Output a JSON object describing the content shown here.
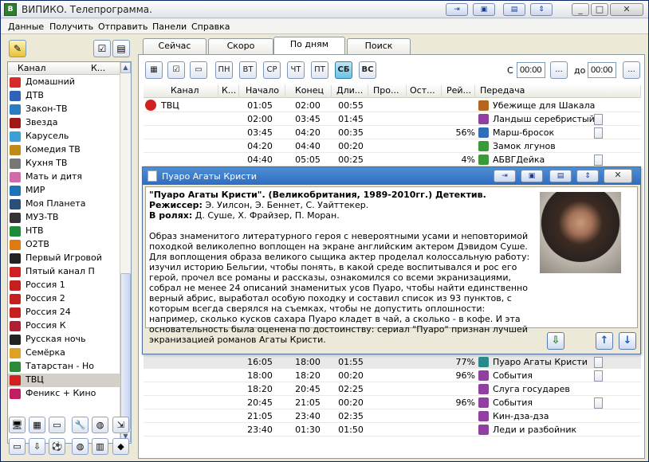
{
  "window": {
    "title": "ВИПИКО. Телепрограмма."
  },
  "menu": [
    "Данные",
    "Получить",
    "Отправить",
    "Панели",
    "Справка"
  ],
  "left_panel": {
    "headers": {
      "channel": "Канал",
      "short": "К..."
    },
    "channels": [
      {
        "name": "Домашний",
        "color": "#d72a2a"
      },
      {
        "name": "ДТВ",
        "color": "#3062b8"
      },
      {
        "name": "Закон-ТВ",
        "color": "#2c7cc1"
      },
      {
        "name": "Звезда",
        "color": "#a01818"
      },
      {
        "name": "Карусель",
        "color": "#3aa0d8"
      },
      {
        "name": "Комедия ТВ",
        "color": "#c08a18"
      },
      {
        "name": "Кухня ТВ",
        "color": "#777777"
      },
      {
        "name": "Мать и дитя",
        "color": "#d06aa8"
      },
      {
        "name": "МИР",
        "color": "#1c74b8"
      },
      {
        "name": "Моя Планета",
        "color": "#2a4f7a"
      },
      {
        "name": "МУЗ-ТВ",
        "color": "#333333"
      },
      {
        "name": "НТВ",
        "color": "#1f8a3a"
      },
      {
        "name": "О2ТВ",
        "color": "#e07a10"
      },
      {
        "name": "Первый Игровой",
        "color": "#222222"
      },
      {
        "name": "Пятый канал П",
        "color": "#d02020"
      },
      {
        "name": "Россия 1",
        "color": "#c42020"
      },
      {
        "name": "Россия 2",
        "color": "#c42020"
      },
      {
        "name": "Россия 24",
        "color": "#c42020"
      },
      {
        "name": "Россия К",
        "color": "#b02030"
      },
      {
        "name": "Русская ночь",
        "color": "#222222"
      },
      {
        "name": "Семёрка",
        "color": "#e0a020"
      },
      {
        "name": "Татарстан - Но",
        "color": "#2a8a3a"
      },
      {
        "name": "ТВЦ",
        "color": "#d02020",
        "selected": true
      },
      {
        "name": "Феникс + Кино",
        "color": "#c02060"
      }
    ]
  },
  "tabs": [
    "Сейчас",
    "Скоро",
    "По дням",
    "Поиск"
  ],
  "active_tab": "По дням",
  "days": [
    "ПН",
    "ВТ",
    "СР",
    "ЧТ",
    "ПТ",
    "СБ",
    "ВС"
  ],
  "selected_day": "СБ",
  "time_filter": {
    "from_label": "С",
    "from_value": "00:00",
    "to_label": "до",
    "to_value": "00:00",
    "browse": "..."
  },
  "grid": {
    "headers": [
      "Канал",
      "К...",
      "Начало",
      "Конец",
      "Дли...",
      "Про...",
      "Ост...",
      "Рей...",
      "Передача"
    ],
    "channel_cell": "ТВЦ",
    "rows_top": [
      {
        "start": "01:05",
        "end": "02:00",
        "dur": "00:55",
        "rating": "",
        "title": "Убежище для Шакала",
        "icon_color": "#b5651d",
        "doc": false
      },
      {
        "start": "02:00",
        "end": "03:45",
        "dur": "01:45",
        "rating": "",
        "title": "Ландыш серебристый",
        "icon_color": "#9040a0",
        "doc": true
      },
      {
        "start": "03:45",
        "end": "04:20",
        "dur": "00:35",
        "rating": "56%",
        "title": "Марш-бросок",
        "icon_color": "#2f6fb5",
        "doc": true
      },
      {
        "start": "04:20",
        "end": "04:40",
        "dur": "00:20",
        "rating": "",
        "title": "Замок лгунов",
        "icon_color": "#3a9a3a",
        "doc": false
      },
      {
        "start": "04:40",
        "end": "05:05",
        "dur": "00:25",
        "rating": "4%",
        "title": "АБВГДейка",
        "icon_color": "#3a9a3a",
        "doc": true
      }
    ],
    "rows_bottom": [
      {
        "start": "16:05",
        "end": "18:00",
        "dur": "01:55",
        "rating": "77%",
        "title": "Пуаро Агаты Кристи",
        "icon_color": "#2a8a8a",
        "doc": true
      },
      {
        "start": "18:00",
        "end": "18:20",
        "dur": "00:20",
        "rating": "96%",
        "title": "События",
        "icon_color": "#9040a0",
        "doc": true
      },
      {
        "start": "18:20",
        "end": "20:45",
        "dur": "02:25",
        "rating": "",
        "title": "Слуга государев",
        "icon_color": "#9040a0",
        "doc": false
      },
      {
        "start": "20:45",
        "end": "21:05",
        "dur": "00:20",
        "rating": "96%",
        "title": "События",
        "icon_color": "#9040a0",
        "doc": true
      },
      {
        "start": "21:05",
        "end": "23:40",
        "dur": "02:35",
        "rating": "",
        "title": "Кин-дза-дза",
        "icon_color": "#9040a0",
        "doc": false
      },
      {
        "start": "23:40",
        "end": "01:30",
        "dur": "01:50",
        "rating": "",
        "title": "Леди и разбойник",
        "icon_color": "#9040a0",
        "doc": false
      }
    ]
  },
  "popup": {
    "title": "Пуаро Агаты Кристи",
    "headline": "\"Пуаро Агаты Кристи\". (Великобритания, 1989-2010гг.) Детектив.",
    "director_label": "Режиссер:",
    "director": "Э. Уилсон, Э. Беннет, С. Уайттекер.",
    "cast_label": "В ролях:",
    "cast": "Д. Суше, Х. Фрайзер, П. Моран.",
    "description": "Образ знаменитого литературного героя с невероятными усами и неповторимой походкой великолепно воплощен на экране английским актером Дэвидом Суше. Для воплощения образа великого сыщика актер проделал колоссальную работу: изучил историю Бельгии, чтобы понять, в какой среде воспитывался и рос его герой, прочел все романы и рассказы, ознакомился со всеми экранизациями, собрал не менее 24 описаний знаменитых усов Пуаро, чтобы найти единственно верный абрис, выработал особую походку и составил список из 93 пунктов, с которым всегда сверялся на съемках, чтобы не допустить оплошности: например, сколько кусков сахара Пуаро кладет в чай, а сколько - в кофе. И эта основательность была оценена по достоинству: сериал \"Пуаро\" признан лучшей экранизацией романов Агаты Кристи."
  }
}
